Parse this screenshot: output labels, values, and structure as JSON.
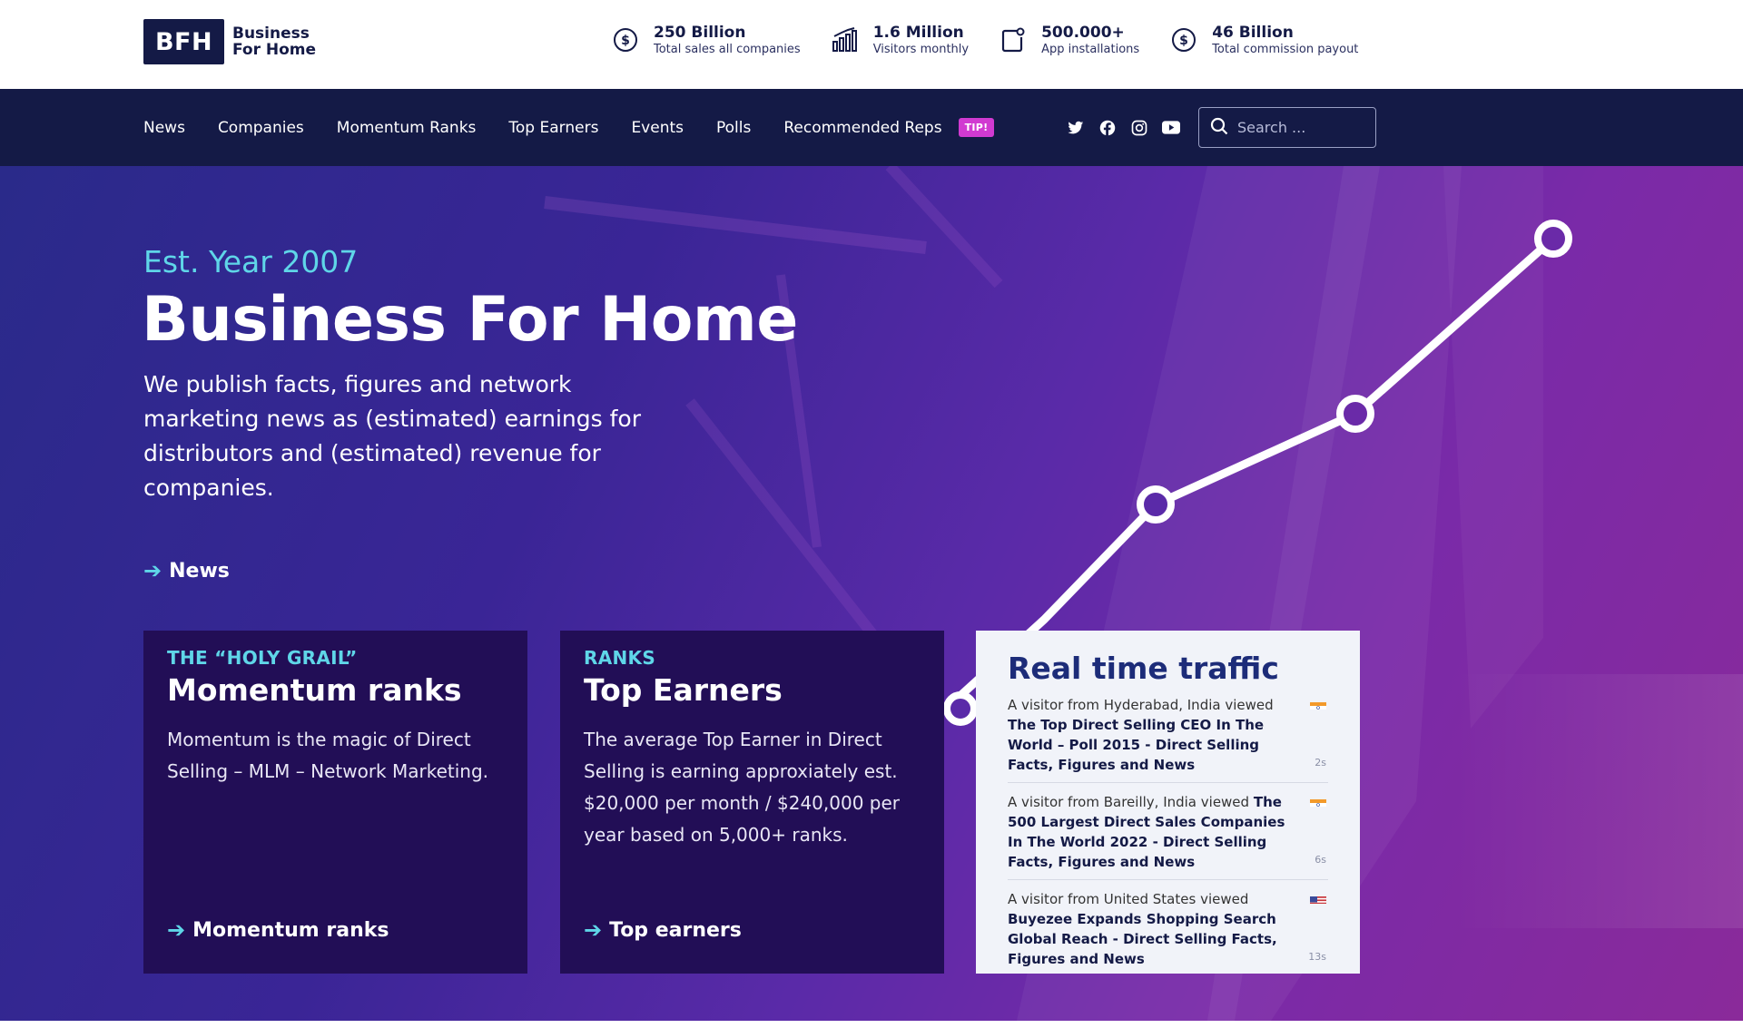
{
  "logo": {
    "mark": "BFH",
    "line1": "Business",
    "line2": "For Home"
  },
  "stats": [
    {
      "icon": "dollar-circle-icon",
      "value": "250 Billion",
      "label": "Total sales all companies"
    },
    {
      "icon": "bar-chart-icon",
      "value": "1.6 Million",
      "label": "Visitors monthly"
    },
    {
      "icon": "app-install-icon",
      "value": "500.000+",
      "label": "App installations"
    },
    {
      "icon": "dollar-circle-icon",
      "value": "46 Billion",
      "label": "Total commission payout"
    }
  ],
  "nav": {
    "items": [
      "News",
      "Companies",
      "Momentum Ranks",
      "Top Earners",
      "Events",
      "Polls",
      "Recommended Reps"
    ],
    "badge": "TIP!",
    "socials": [
      "twitter-icon",
      "facebook-icon",
      "instagram-icon",
      "youtube-icon"
    ],
    "search_placeholder": "Search ..."
  },
  "hero": {
    "est": "Est. Year 2007",
    "title": "Business For Home",
    "description": "We publish facts, figures and network marketing news as (estimated) earnings for distributors and (estimated) revenue for companies.",
    "link": "News"
  },
  "cards": [
    {
      "kicker": "THE “HOLY GRAIL”",
      "title": "Momentum ranks",
      "text": "Momentum is the magic of Direct Selling – MLM – Network Marketing.",
      "link": "Momentum ranks"
    },
    {
      "kicker": "RANKS",
      "title": "Top Earners",
      "text": "The average Top Earner in Direct Selling is earning approxiately est. $20,000 per month / $240,000 per year based on 5,000+ ranks.",
      "link": "Top earners"
    }
  ],
  "traffic": {
    "title": "Real time traffic",
    "visits": [
      {
        "prefix": "A visitor from Hyderabad, India viewed",
        "title": "The Top Direct Selling CEO In The World – Poll 2015 - Direct Selling Facts, Figures and News",
        "age": "2s",
        "flag": "india"
      },
      {
        "prefix": "A visitor from Bareilly, India viewed",
        "title": "The 500 Largest Direct Sales Companies In The World 2022 - Direct Selling Facts, Figures and News",
        "age": "6s",
        "flag": "india"
      },
      {
        "prefix": "A visitor from United States viewed",
        "title": "Buyezee Expands Shopping Search Global Reach - Direct Selling Facts, Figures and News",
        "age": "13s",
        "flag": "usa"
      }
    ]
  },
  "colors": {
    "navy": "#141a46",
    "accent": "#5fd6e8",
    "badge": "#d13ad1",
    "card": "#220e56",
    "traffic_title": "#1d2c79"
  }
}
